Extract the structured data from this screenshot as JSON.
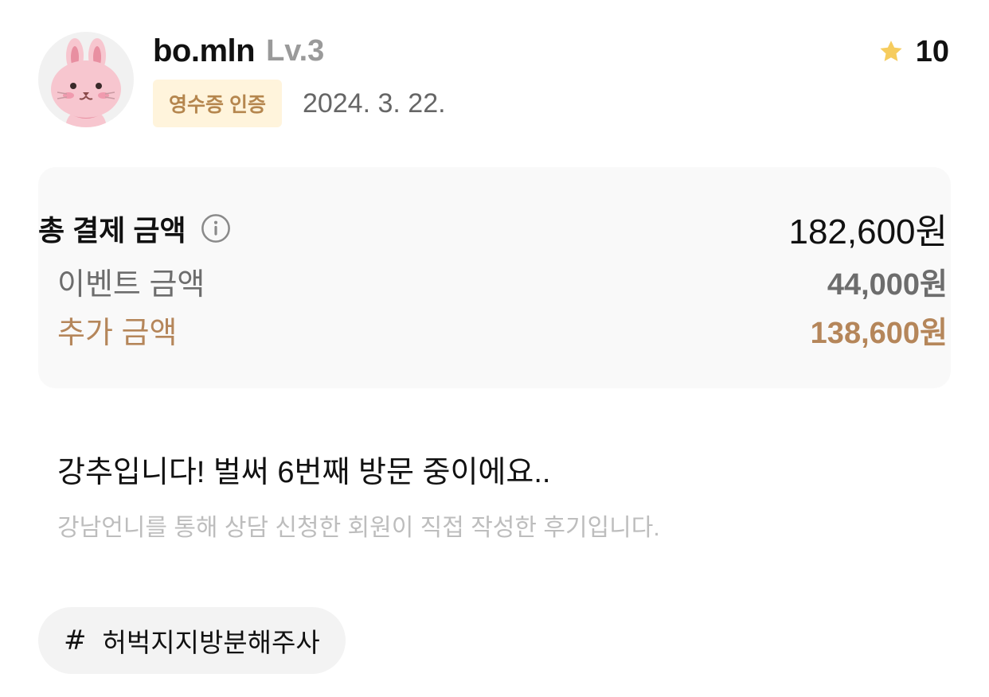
{
  "user": {
    "name": "bo.mln",
    "level": "Lv.3",
    "avatar_icon": "bunny-avatar-icon"
  },
  "rating": {
    "icon": "star-icon",
    "value": "10",
    "star_color": "#f6cc5e"
  },
  "meta": {
    "badge": "영수증 인증",
    "date": "2024. 3. 22."
  },
  "payment": {
    "total_label": "총 결제 금액",
    "total_amount": "182,600원",
    "event_label": "이벤트 금액",
    "event_amount": "44,000원",
    "extra_label": "추가 금액",
    "extra_amount": "138,600원",
    "accent_color": "#b5865a"
  },
  "review": {
    "title": "강추입니다! 벌써 6번째 방문 중이에요..",
    "disclaimer": "강남언니를 통해 상담 신청한 회원이 직접 작성한 후기입니다."
  },
  "hashtag": {
    "symbol": "#",
    "label": "허벅지지방분해주사"
  }
}
